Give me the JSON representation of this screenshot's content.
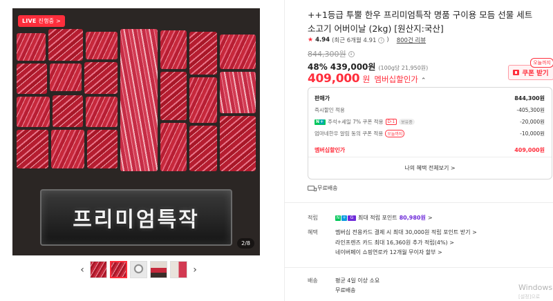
{
  "gallery": {
    "live_badge": "LIVE",
    "live_status": "진행중 >",
    "image_text": "프리미엄특작",
    "counter": "2/8",
    "prev_icon": "chevron-left-icon",
    "next_icon": "chevron-right-icon",
    "thumb_count": 5,
    "active_thumb": 2
  },
  "product": {
    "title": "++1등급 투뿔 한우 프리미엄특작 명품 구이용 모듬 선물 세트 소고기 어버이날 (2kg) [원산지:국산]",
    "rating": "4.94",
    "rating_recent": "(최근 6개월 4.91",
    "rating_recent_close": ")",
    "review_link": "800건 리뷰",
    "original_price": "844,300원",
    "discount_percent": "48%",
    "discount_price": "439,000원",
    "unit_price": "(100g당 21,950원)",
    "final_price": "409,000",
    "final_unit": "원",
    "final_label": "멤버십할인가",
    "coupon": {
      "tag": "오늘까지",
      "label": "쿠폰 받기"
    }
  },
  "benefits": {
    "rows": [
      {
        "label": "판매가",
        "value": "844,300원"
      },
      {
        "label": "즉시할인 적용",
        "value": "-405,300원"
      },
      {
        "label": "주석+세일 7% 쿠폰 적용",
        "tag": "D-1",
        "tag2": "보유중",
        "value": "-20,000원"
      },
      {
        "label": "엄마네한우 알림 동의 쿠폰 적용",
        "tag": "오늘까지",
        "value": "-10,000원"
      }
    ],
    "total_label": "멤버십할인가",
    "total_value": "409,000원",
    "view_all": "나의 혜택 전체보기 >"
  },
  "shipping": {
    "free_label": "무료배송"
  },
  "info": {
    "points_label": "적립",
    "points_text": "최대 적립 포인트",
    "points_value": "80,980원",
    "points_chevron": ">",
    "benefit_label": "혜택",
    "benefit_lines": [
      "멤버십 전용카드 결제 시 최대 30,000원 적립 포인트 받기 >",
      "라인프렌즈 카드 최대 16,360원 추가 적립(4%) >",
      "네이버페이 쇼핑연로카 12개월 무이자 할부 >"
    ],
    "delivery_label": "배송",
    "delivery_lines": [
      "평균 4일 이상 소요",
      "무료배송"
    ]
  },
  "os_watermark": {
    "line1": "Windows",
    "line2": "[설정]으로"
  },
  "colors": {
    "accent_red": "#ff2e3c",
    "naver_green": "#03c75a",
    "points_purple": "#6f2bd9"
  }
}
